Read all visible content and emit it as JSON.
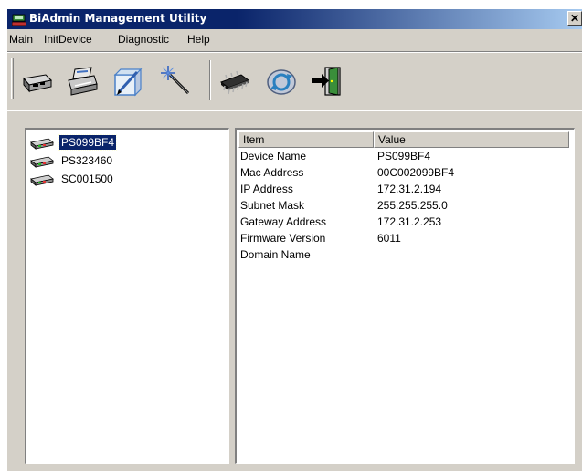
{
  "window": {
    "title": "BiAdmin Management Utility",
    "close_glyph": "✕"
  },
  "menu": [
    "Main",
    "InitDevice",
    "Diagnostic",
    "Help"
  ],
  "toolbar": {
    "buttons": [
      {
        "icon": "network-device-icon"
      },
      {
        "icon": "printer-icon"
      },
      {
        "icon": "edit-pencil-icon"
      },
      {
        "icon": "magic-wand-icon"
      },
      {
        "icon": "chip-icon"
      },
      {
        "icon": "refresh-icon"
      },
      {
        "icon": "exit-door-icon"
      }
    ]
  },
  "devices": [
    {
      "name": "PS099BF4",
      "selected": true
    },
    {
      "name": "PS323460",
      "selected": false
    },
    {
      "name": "SC001500",
      "selected": false
    }
  ],
  "properties": {
    "headers": {
      "item": "Item",
      "value": "Value"
    },
    "rows": [
      {
        "item": "Device Name",
        "value": "PS099BF4"
      },
      {
        "item": "Mac Address",
        "value": "00C002099BF4"
      },
      {
        "item": "IP Address",
        "value": "172.31.2.194"
      },
      {
        "item": "Subnet Mask",
        "value": "255.255.255.0"
      },
      {
        "item": "Gateway Address",
        "value": "172.31.2.253"
      },
      {
        "item": "Firmware Version",
        "value": "6011"
      },
      {
        "item": "Domain Name",
        "value": ""
      }
    ]
  },
  "colors": {
    "title_bar": "#0a246a",
    "face": "#d4d0c8",
    "selection": "#0a246a"
  }
}
